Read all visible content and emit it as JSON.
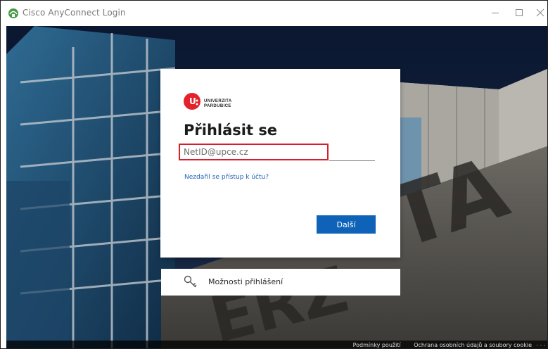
{
  "window": {
    "title": "Cisco AnyConnect Login",
    "controls": [
      "minimize-icon",
      "maximize-icon",
      "close-icon"
    ]
  },
  "login": {
    "logo_line1": "UNIVERZITA",
    "logo_line2": "PARDUBICE",
    "heading": "Přihlásit se",
    "email_placeholder": "NetID@upce.cz",
    "help_link": "Nezdařil se přístup k účtu?",
    "next_label": "Další"
  },
  "sign_in_options": {
    "label": "Možnosti přihlášení",
    "icon": "key-icon"
  },
  "footer": {
    "terms": "Podmínky použití",
    "privacy": "Ochrana osobních údajů a soubory cookie",
    "more": "· · ·"
  },
  "colors": {
    "accent": "#0e63b8",
    "link": "#1f60b6",
    "highlight": "#d4202c",
    "brand": "#e3222b"
  }
}
